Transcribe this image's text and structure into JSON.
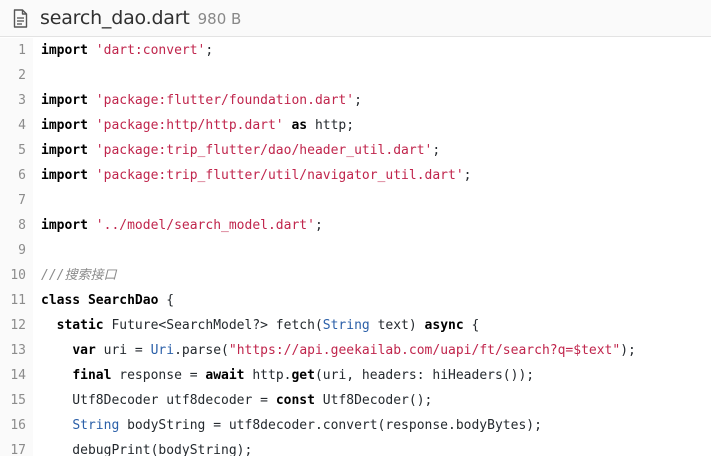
{
  "file": {
    "icon": "file-document-icon",
    "name": "search_dao.dart",
    "size": "980 B"
  },
  "colors": {
    "keyword": "#000000",
    "string": "#c0254c",
    "comment": "#8a8a8a",
    "type": "#2a5fa8",
    "line_number": "#8c8c8c"
  },
  "lines": [
    {
      "n": "1",
      "tokens": [
        [
          "kw",
          "import"
        ],
        [
          "p",
          " "
        ],
        [
          "str",
          "'dart:convert'"
        ],
        [
          "p",
          ";"
        ]
      ]
    },
    {
      "n": "2",
      "tokens": []
    },
    {
      "n": "3",
      "tokens": [
        [
          "kw",
          "import"
        ],
        [
          "p",
          " "
        ],
        [
          "str",
          "'package:flutter/foundation.dart'"
        ],
        [
          "p",
          ";"
        ]
      ]
    },
    {
      "n": "4",
      "tokens": [
        [
          "kw",
          "import"
        ],
        [
          "p",
          " "
        ],
        [
          "str",
          "'package:http/http.dart'"
        ],
        [
          "p",
          " "
        ],
        [
          "kw",
          "as"
        ],
        [
          "p",
          " http;"
        ]
      ]
    },
    {
      "n": "5",
      "tokens": [
        [
          "kw",
          "import"
        ],
        [
          "p",
          " "
        ],
        [
          "str",
          "'package:trip_flutter/dao/header_util.dart'"
        ],
        [
          "p",
          ";"
        ]
      ]
    },
    {
      "n": "6",
      "tokens": [
        [
          "kw",
          "import"
        ],
        [
          "p",
          " "
        ],
        [
          "str",
          "'package:trip_flutter/util/navigator_util.dart'"
        ],
        [
          "p",
          ";"
        ]
      ]
    },
    {
      "n": "7",
      "tokens": []
    },
    {
      "n": "8",
      "tokens": [
        [
          "kw",
          "import"
        ],
        [
          "p",
          " "
        ],
        [
          "str",
          "'../model/search_model.dart'"
        ],
        [
          "p",
          ";"
        ]
      ]
    },
    {
      "n": "9",
      "tokens": []
    },
    {
      "n": "10",
      "tokens": [
        [
          "cmt",
          "///搜索接口"
        ]
      ]
    },
    {
      "n": "11",
      "tokens": [
        [
          "kw",
          "class"
        ],
        [
          "p",
          " "
        ],
        [
          "kw",
          "SearchDao"
        ],
        [
          "p",
          " {"
        ]
      ]
    },
    {
      "n": "12",
      "tokens": [
        [
          "p",
          "  "
        ],
        [
          "kw",
          "static"
        ],
        [
          "p",
          " Future<SearchModel?> fetch("
        ],
        [
          "type",
          "String"
        ],
        [
          "p",
          " text) "
        ],
        [
          "kw",
          "async"
        ],
        [
          "p",
          " {"
        ]
      ]
    },
    {
      "n": "13",
      "tokens": [
        [
          "p",
          "    "
        ],
        [
          "kw",
          "var"
        ],
        [
          "p",
          " uri = "
        ],
        [
          "type",
          "Uri"
        ],
        [
          "p",
          ".parse("
        ],
        [
          "str",
          "\"https://api.geekailab.com/uapi/ft/search?q=$text\""
        ],
        [
          "p",
          ");"
        ]
      ]
    },
    {
      "n": "14",
      "tokens": [
        [
          "p",
          "    "
        ],
        [
          "kw",
          "final"
        ],
        [
          "p",
          " response = "
        ],
        [
          "kw",
          "await"
        ],
        [
          "p",
          " http."
        ],
        [
          "kw",
          "get"
        ],
        [
          "p",
          "(uri, headers: hiHeaders());"
        ]
      ]
    },
    {
      "n": "15",
      "tokens": [
        [
          "p",
          "    Utf8Decoder utf8decoder = "
        ],
        [
          "kw",
          "const"
        ],
        [
          "p",
          " Utf8Decoder();"
        ]
      ]
    },
    {
      "n": "16",
      "tokens": [
        [
          "p",
          "    "
        ],
        [
          "type",
          "String"
        ],
        [
          "p",
          " bodyString = utf8decoder.convert(response.bodyBytes);"
        ]
      ]
    },
    {
      "n": "17",
      "tokens": [
        [
          "p",
          "    debugPrint(bodyString);"
        ]
      ]
    }
  ]
}
